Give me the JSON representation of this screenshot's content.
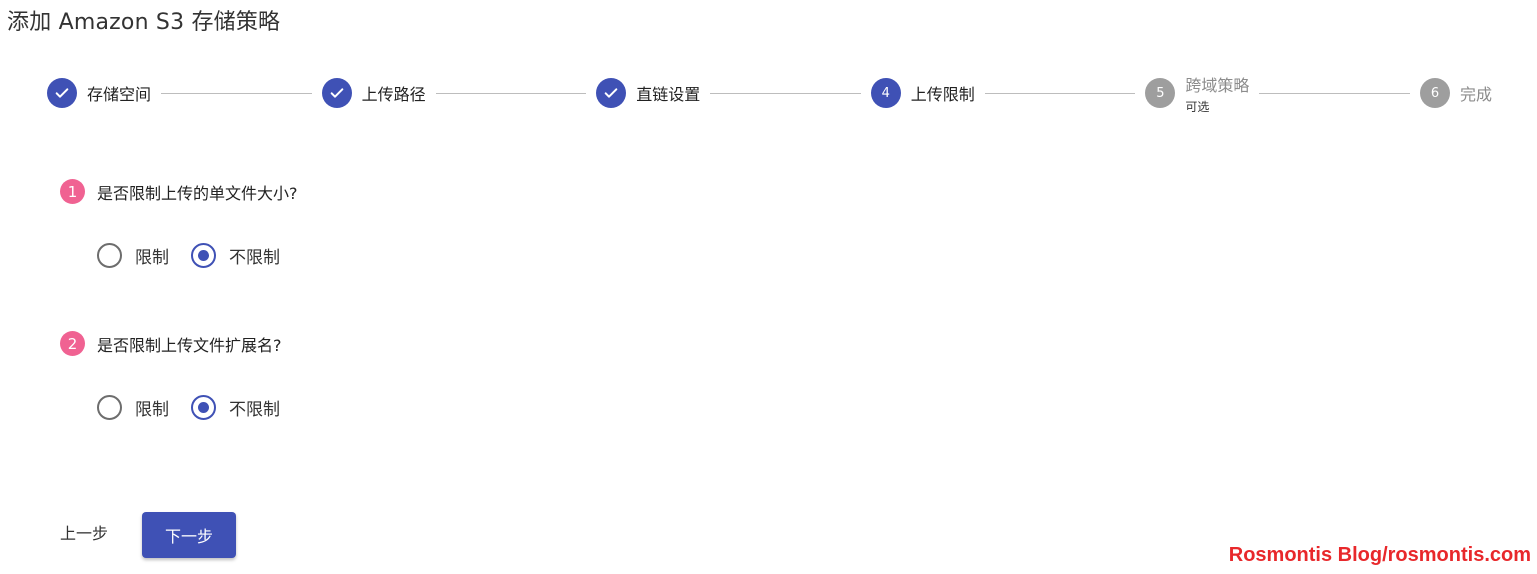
{
  "page": {
    "title": "添加 Amazon S3 存储策略"
  },
  "stepper": {
    "steps": [
      {
        "label": "存储空间",
        "status": "done"
      },
      {
        "label": "上传路径",
        "status": "done"
      },
      {
        "label": "直链设置",
        "status": "done"
      },
      {
        "label": "上传限制",
        "status": "active",
        "number": "4"
      },
      {
        "label": "跨域策略",
        "status": "pending",
        "number": "5",
        "sub": "可选"
      },
      {
        "label": "完成",
        "status": "pending",
        "number": "6"
      }
    ]
  },
  "questions": [
    {
      "number": "1",
      "text": "是否限制上传的单文件大小?",
      "options": [
        {
          "label": "限制",
          "checked": false
        },
        {
          "label": "不限制",
          "checked": true
        }
      ]
    },
    {
      "number": "2",
      "text": "是否限制上传文件扩展名?",
      "options": [
        {
          "label": "限制",
          "checked": false
        },
        {
          "label": "不限制",
          "checked": true
        }
      ]
    }
  ],
  "actions": {
    "back_label": "上一步",
    "next_label": "下一步"
  },
  "watermark": {
    "text": "Rosmontis Blog/rosmontis.com"
  },
  "colors": {
    "primary": "#3f51b5",
    "pending": "#9e9e9e",
    "question_badge": "#f06292",
    "watermark": "#e8282b"
  }
}
